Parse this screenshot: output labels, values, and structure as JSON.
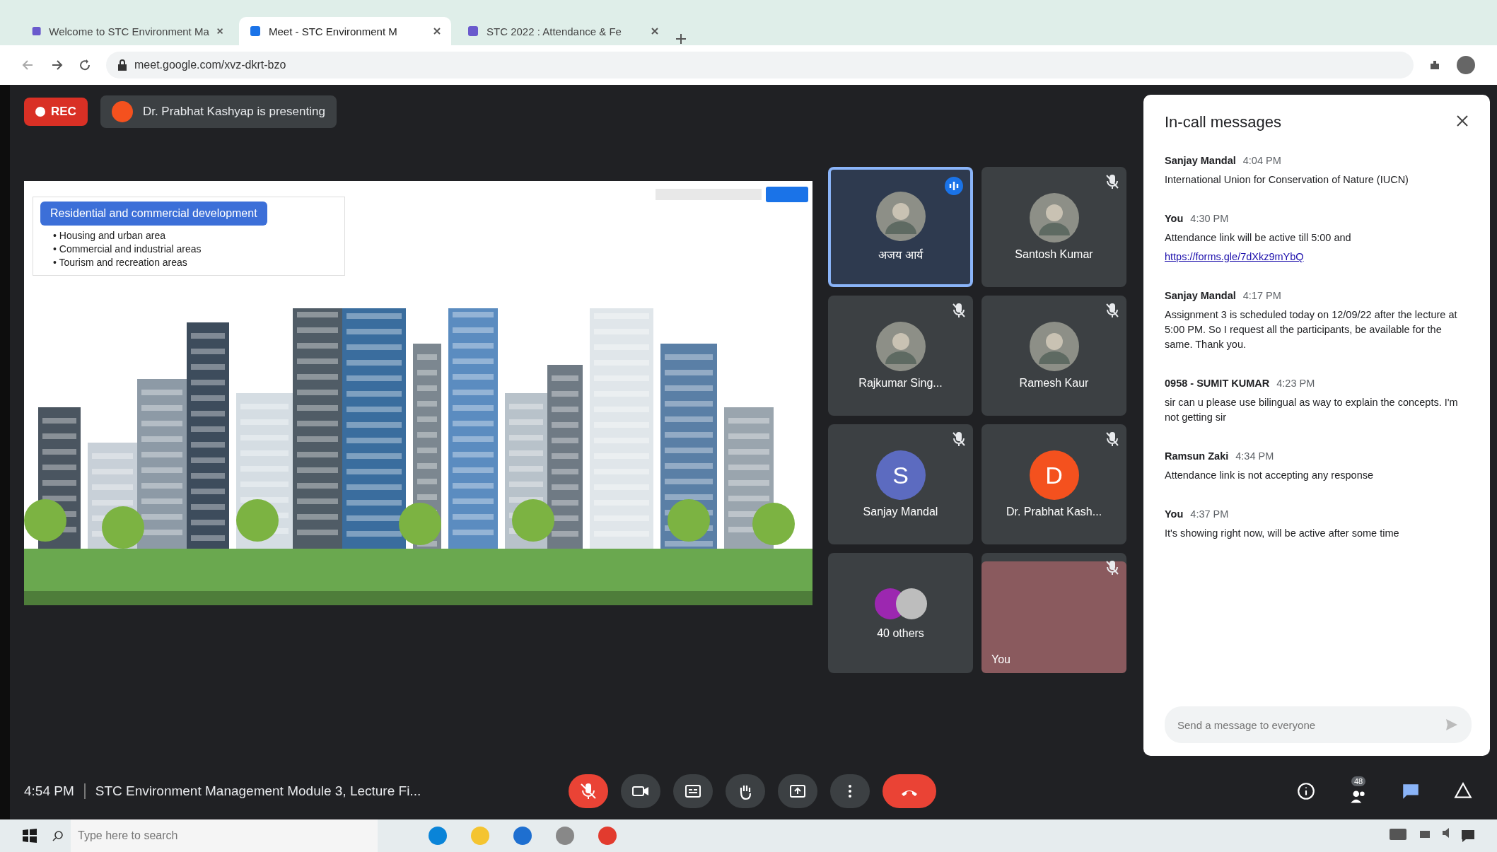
{
  "browser": {
    "tabs": [
      {
        "title": "Welcome to STC Environment Ma",
        "selected": false
      },
      {
        "title": "Meet - STC Environment M",
        "selected": true
      },
      {
        "title": "STC 2022 : Attendance & Fe",
        "selected": false
      }
    ],
    "address": "meet.google.com/xvz-dkrt-bzo"
  },
  "meeting": {
    "recording_label": "REC",
    "presenter_text": "Dr. Prabhat Kashyap is presenting"
  },
  "slide": {
    "title": "Residential and commercial development",
    "bullets": [
      "• Housing and urban area",
      "• Commercial and industrial areas",
      "• Tourism and recreation areas"
    ]
  },
  "tiles": [
    {
      "kind": "photo",
      "name": "अजय आर्य",
      "speaking": true,
      "muted": false
    },
    {
      "kind": "photo",
      "name": "Santosh Kumar",
      "speaking": false,
      "muted": true
    },
    {
      "kind": "photo",
      "name": "Rajkumar Sing...",
      "speaking": false,
      "muted": true
    },
    {
      "kind": "photo",
      "name": "Ramesh Kaur",
      "speaking": false,
      "muted": true
    },
    {
      "kind": "letter",
      "name": "Sanjay Mandal",
      "initial": "S",
      "color": "#5c6bc0",
      "speaking": false,
      "muted": true
    },
    {
      "kind": "letter",
      "name": "Dr. Prabhat Kash...",
      "initial": "D",
      "color": "#f4511e",
      "speaking": false,
      "muted": true
    },
    {
      "kind": "others",
      "name": "40 others",
      "speaking": false,
      "muted": false
    },
    {
      "kind": "video",
      "name": "You",
      "speaking": false,
      "muted": true
    }
  ],
  "chat": {
    "title": "In-call messages",
    "messages": [
      {
        "sender": "Sanjay Mandal",
        "time": "4:04 PM",
        "text": "International Union for Conservation of Nature (IUCN)"
      },
      {
        "sender": "You",
        "time": "4:30 PM",
        "text": "Attendance link will be active till 5:00 and",
        "link": "https://forms.gle/7dXkz9mYbQ"
      },
      {
        "sender": "Sanjay Mandal",
        "time": "4:17 PM",
        "text": "Assignment 3 is scheduled today on 12/09/22 after the lecture at 5:00 PM. So I request all the participants, be available for the same. Thank you."
      },
      {
        "sender": "0958 - SUMIT KUMAR",
        "time": "4:23 PM",
        "text": "sir can u please use bilingual as way to explain the concepts. I'm not getting sir"
      },
      {
        "sender": "Ramsun Zaki",
        "time": "4:34 PM",
        "text": "Attendance link is not accepting any response"
      },
      {
        "sender": "You",
        "time": "4:37 PM",
        "text": "It's showing right now, will be active after some time"
      }
    ],
    "placeholder": "Send a message to everyone"
  },
  "controls": {
    "time": "4:54 PM",
    "meeting_title": "STC Environment Management Module 3, Lecture Fi...",
    "buttons": [
      {
        "kind": "mic",
        "on": false
      },
      {
        "kind": "camera",
        "on": true
      },
      {
        "kind": "captions"
      },
      {
        "kind": "hand"
      },
      {
        "kind": "present"
      },
      {
        "kind": "more"
      },
      {
        "kind": "leave"
      }
    ],
    "side": [
      {
        "kind": "info"
      },
      {
        "kind": "people",
        "count": "48"
      },
      {
        "kind": "chat",
        "selected": true
      },
      {
        "kind": "activities"
      }
    ]
  },
  "taskbar": {
    "search_placeholder": "Type here to search"
  }
}
